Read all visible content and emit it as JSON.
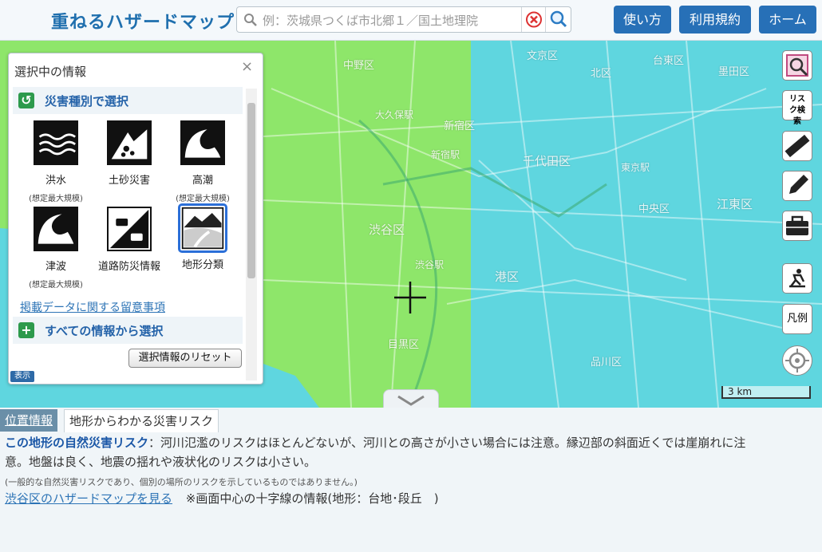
{
  "header": {
    "title": "重ねるハザードマップ",
    "search_placeholder": "例：茨城県つくば市北郷１／国土地理院",
    "buttons": [
      "使い方",
      "利用規約",
      "ホーム"
    ]
  },
  "panel": {
    "title": "選択中の情報",
    "close_label": "×",
    "section_by_type": "災害種別で選択",
    "hazards": [
      {
        "name": "洪水",
        "sub": "(想定最大規模)",
        "icon": "flood-icon"
      },
      {
        "name": "土砂災害",
        "sub": "",
        "icon": "landslide-icon"
      },
      {
        "name": "高潮",
        "sub": "(想定最大規模)",
        "icon": "storm-surge-icon"
      },
      {
        "name": "津波",
        "sub": "(想定最大規模)",
        "icon": "tsunami-icon"
      },
      {
        "name": "道路防災情報",
        "sub": "",
        "icon": "road-disaster-icon"
      },
      {
        "name": "地形分類",
        "sub": "",
        "icon": "landform-icon",
        "selected": true
      }
    ],
    "notes_link": "掲載データに関する留意事項",
    "section_all": "すべての情報から選択",
    "reset_button": "選択情報のリセット",
    "display_badge": "表示"
  },
  "map": {
    "labels": [
      "中野区",
      "新宿区",
      "文京区",
      "台東区",
      "墨田区",
      "千代田区",
      "渋谷区",
      "港区",
      "中央区",
      "江東区",
      "目黒区",
      "品川区",
      "新宿駅",
      "渋谷駅",
      "東京駅",
      "大久保駅",
      "北区"
    ],
    "scale_label": "3 km",
    "tools": [
      {
        "icon": "area-search-icon",
        "label": ""
      },
      {
        "icon": "risk-search-icon",
        "label": "リスク検索"
      },
      {
        "icon": "ruler-icon",
        "label": ""
      },
      {
        "icon": "pencil-icon",
        "label": ""
      },
      {
        "icon": "toolbox-icon",
        "label": ""
      },
      {
        "icon": "evacuation-icon",
        "label": ""
      },
      {
        "icon": "legend-icon",
        "label": "凡例"
      },
      {
        "icon": "current-location-icon",
        "label": ""
      }
    ],
    "colors": {
      "flood_zone": "#5fd6df",
      "landform_green": "#8ee66a"
    }
  },
  "bottom": {
    "tabs": [
      "位置情報",
      "地形からわかる災害リスク"
    ],
    "risk_title": "この地形の自然災害リスク",
    "risk_text": "：河川氾濫のリスクはほとんどないが、河川との高さが小さい場合には注意。縁辺部の斜面近くでは崖崩れに注",
    "risk_text2": "意。地盤は良く、地震の揺れや液状化のリスクは小さい。",
    "note": "(一般的な自然災害リスクであり、個別の場所のリスクを示しているものではありません。)",
    "ward_link": "渋谷区のハザードマップを見る",
    "center_info": "※画面中心の十字線の情報(地形：台地･段丘　)"
  }
}
